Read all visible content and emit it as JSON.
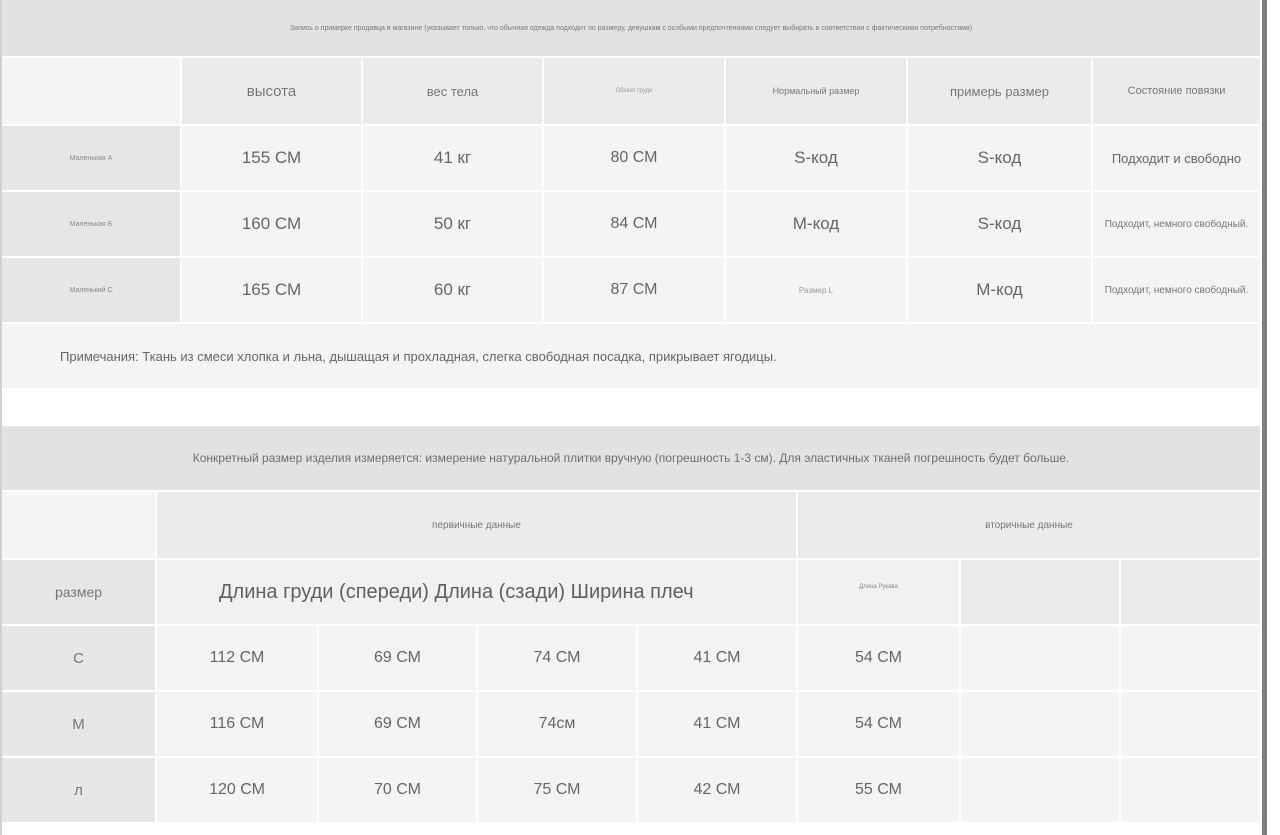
{
  "fitting": {
    "banner": "Запись о примерке продавца в магазине (указывает только, что обычная одежда подходит по размеру, девушкам с особыми предпочтениями следует выбирать в соответствии с фактическими потребностями)",
    "headers": [
      "высота",
      "вес тела",
      "Обхват груди",
      "Нормальный размер",
      "примерь размер",
      "Состояние повязки"
    ],
    "rows": [
      {
        "label": "Маленькая А",
        "height": "155 СМ",
        "weight": "41 кг",
        "bust": "80 СМ",
        "normal": "S-код",
        "tried": "S-код",
        "state": "Подходит и свободно"
      },
      {
        "label": "Маленькая Б",
        "height": "160 СМ",
        "weight": "50 кг",
        "bust": "84 СМ",
        "normal": "М-код",
        "tried": "S-код",
        "state": "Подходит, немного свободный."
      },
      {
        "label": "Маленький С",
        "height": "165 СМ",
        "weight": "60 кг",
        "bust": "87 СМ",
        "normal": "Размер L",
        "tried": "М-код",
        "state": "Подходит, немного свободный."
      }
    ],
    "note": "Примечания: Ткань из смеси хлопка и льна, дышащая и прохладная, слегка свободная посадка, прикрывает ягодицы."
  },
  "measure": {
    "banner": "Конкретный размер изделия измеряется: измерение натуральной плитки вручную (погрешность 1-3 см). Для эластичных тканей погрешность будет больше.",
    "group_primary": "первичные данные",
    "group_secondary": "вторичные данные",
    "size_label": "размер",
    "columns_text": "Длина груди (спереди) Длина (сзади) Ширина плеч",
    "sleeve_label": "Длина Рукава",
    "rows": [
      {
        "size": "С",
        "bust": "112 СМ",
        "front": "69 СМ",
        "back": "74 СМ",
        "shoulder": "41 СМ",
        "sleeve": "54 СМ"
      },
      {
        "size": "М",
        "bust": "116 СМ",
        "front": "69 СМ",
        "back": "74см",
        "shoulder": "41 СМ",
        "sleeve": "54 СМ"
      },
      {
        "size": "л",
        "bust": "120 СМ",
        "front": "70 СМ",
        "back": "75 СМ",
        "shoulder": "42 СМ",
        "sleeve": "55 СМ"
      }
    ]
  }
}
